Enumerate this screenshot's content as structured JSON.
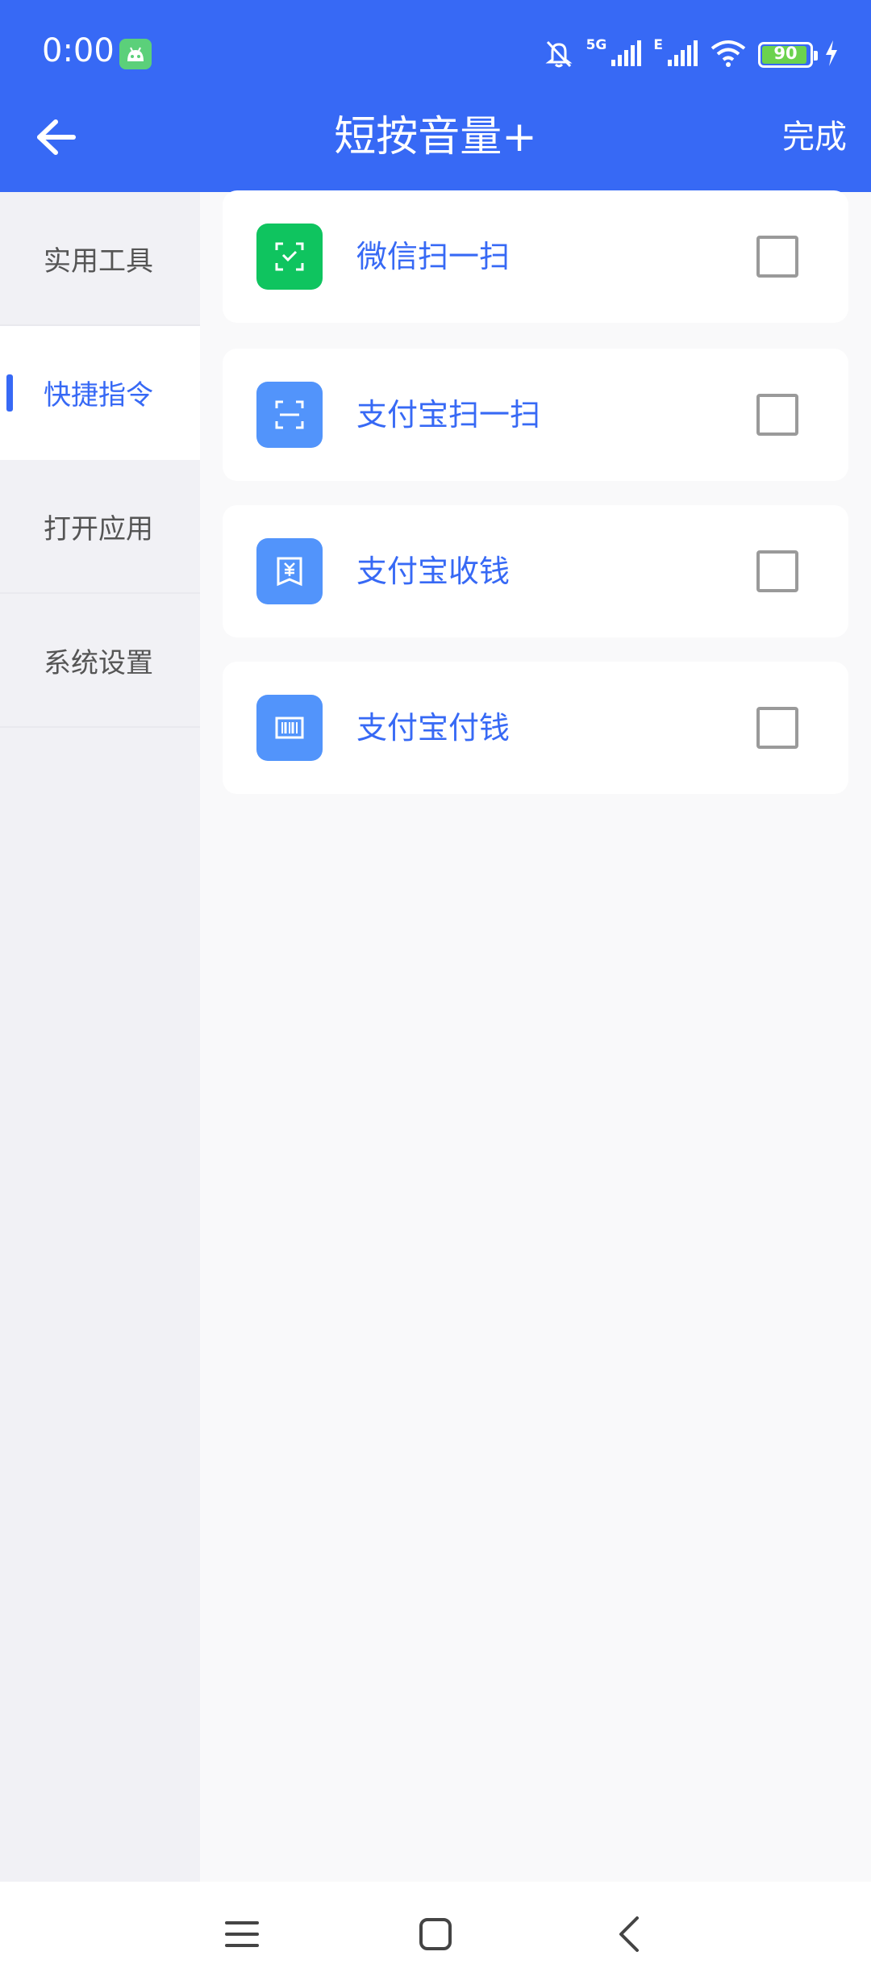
{
  "status_bar": {
    "time": "0:00",
    "network_label": "5G",
    "network2_label": "E",
    "battery_level": "90"
  },
  "header": {
    "title": "短按音量+",
    "done_label": "完成"
  },
  "sidebar": {
    "items": [
      {
        "label": "实用工具"
      },
      {
        "label": "快捷指令",
        "active": true
      },
      {
        "label": "打开应用"
      },
      {
        "label": "系统设置"
      }
    ]
  },
  "actions": [
    {
      "label": "微信扫一扫",
      "icon": "wechat-scan-icon",
      "color": "#0fc45f",
      "checked": false
    },
    {
      "label": "支付宝扫一扫",
      "icon": "alipay-scan-icon",
      "color": "#5294fb",
      "checked": false
    },
    {
      "label": "支付宝收钱",
      "icon": "alipay-receive-icon",
      "color": "#5294fb",
      "checked": false
    },
    {
      "label": "支付宝付钱",
      "icon": "alipay-pay-icon",
      "color": "#5294fb",
      "checked": false
    }
  ],
  "colors": {
    "accent": "#3769f5",
    "wechat_green": "#0fc45f",
    "alipay_blue": "#5294fb"
  }
}
